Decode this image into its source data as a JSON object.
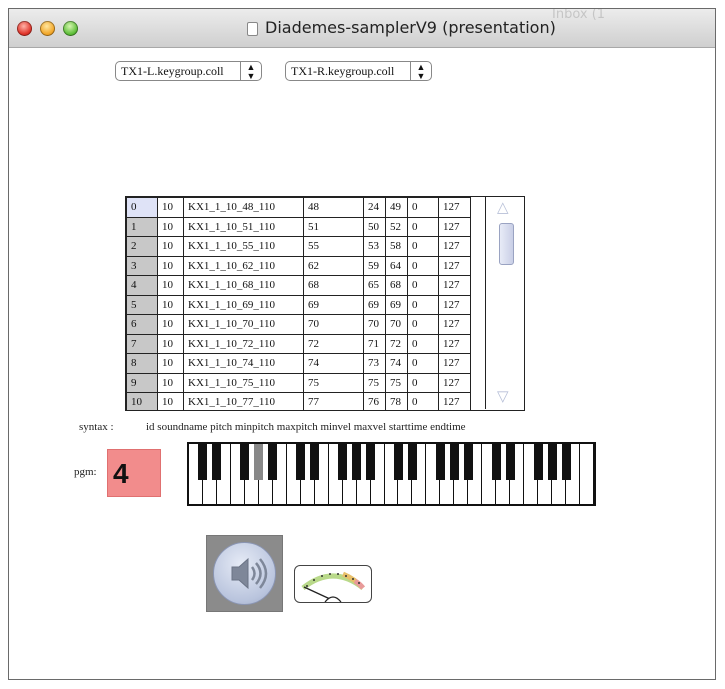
{
  "window": {
    "title": "Diademes-samplerV9 (presentation)",
    "background_title_fragment": "Inbox (1"
  },
  "menus": {
    "left": {
      "value": "TX1-L.keygroup.coll"
    },
    "right": {
      "value": "TX1-R.keygroup.coll"
    }
  },
  "table": {
    "rows": [
      {
        "index": "0",
        "cells": [
          "10",
          "KX1_1_10_48_110",
          "48",
          "24",
          "49",
          "0",
          "127"
        ]
      },
      {
        "index": "1",
        "cells": [
          "10",
          "KX1_1_10_51_110",
          "51",
          "50",
          "52",
          "0",
          "127"
        ]
      },
      {
        "index": "2",
        "cells": [
          "10",
          "KX1_1_10_55_110",
          "55",
          "53",
          "58",
          "0",
          "127"
        ]
      },
      {
        "index": "3",
        "cells": [
          "10",
          "KX1_1_10_62_110",
          "62",
          "59",
          "64",
          "0",
          "127"
        ]
      },
      {
        "index": "4",
        "cells": [
          "10",
          "KX1_1_10_68_110",
          "68",
          "65",
          "68",
          "0",
          "127"
        ]
      },
      {
        "index": "5",
        "cells": [
          "10",
          "KX1_1_10_69_110",
          "69",
          "69",
          "69",
          "0",
          "127"
        ]
      },
      {
        "index": "6",
        "cells": [
          "10",
          "KX1_1_10_70_110",
          "70",
          "70",
          "70",
          "0",
          "127"
        ]
      },
      {
        "index": "7",
        "cells": [
          "10",
          "KX1_1_10_72_110",
          "72",
          "71",
          "72",
          "0",
          "127"
        ]
      },
      {
        "index": "8",
        "cells": [
          "10",
          "KX1_1_10_74_110",
          "74",
          "73",
          "74",
          "0",
          "127"
        ]
      },
      {
        "index": "9",
        "cells": [
          "10",
          "KX1_1_10_75_110",
          "75",
          "75",
          "75",
          "0",
          "127"
        ]
      },
      {
        "index": "10",
        "cells": [
          "10",
          "KX1_1_10_77_110",
          "77",
          "76",
          "78",
          "0",
          "127"
        ]
      }
    ],
    "selected_row": "0"
  },
  "syntax": {
    "label": "syntax :",
    "text": "id soundname pitch minpitch maxpitch minvel maxvel starttime endtime"
  },
  "pgm": {
    "label": "pgm:",
    "value": "4"
  },
  "keyboard": {
    "white_keys": 29,
    "highlighted_black_key": 3
  },
  "icons": {
    "audio": "speaker-icon",
    "gain": "gain-meter-icon",
    "doc": "document-icon"
  },
  "colors": {
    "pgm_bg": "#f28c8c",
    "selected_index_bg": "#dfe3f7",
    "index_bg": "#c8c8c8",
    "audio_btn_bg": "#8b8b8b",
    "highlighted_key": "#888888"
  }
}
